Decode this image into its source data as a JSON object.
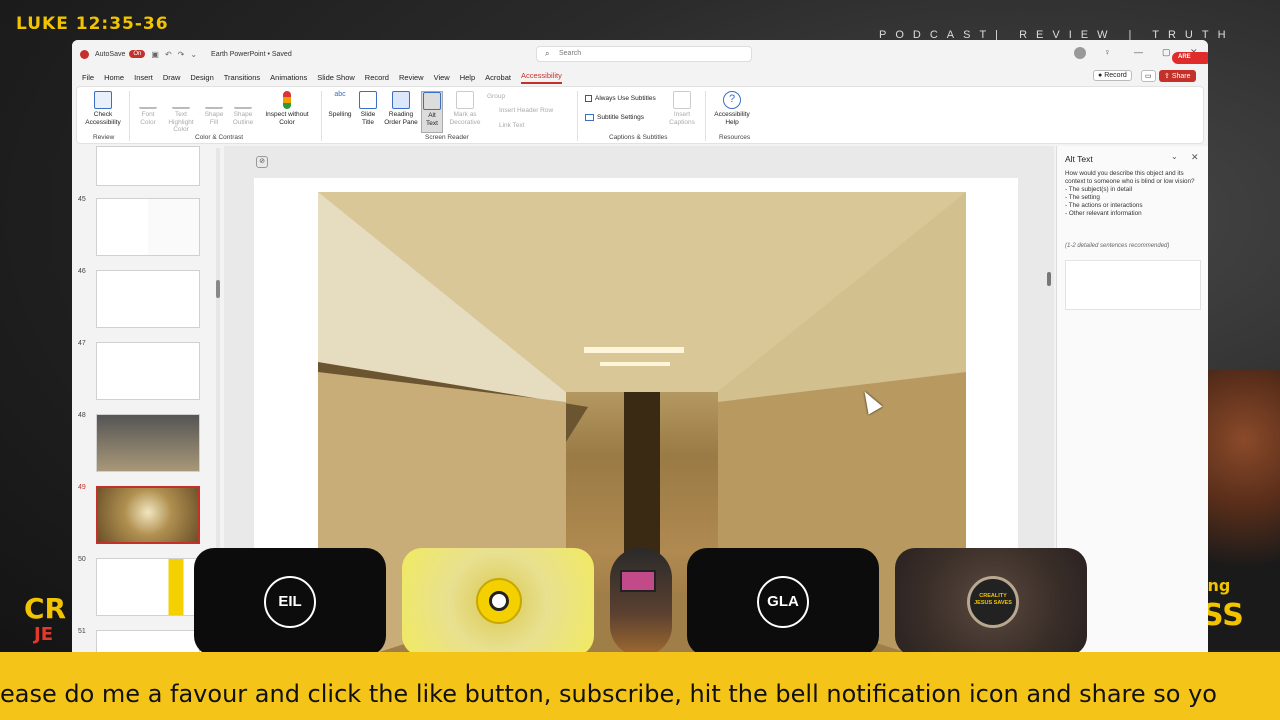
{
  "overlay": {
    "verse": "LUKE 12:35-36",
    "tagline": "PODCAST| REVIEW | TRUTH",
    "ticker": "ease do me a favour and click the like button, subscribe, hit the bell notification icon and share so yo"
  },
  "window": {
    "autosave_label": "AutoSave",
    "autosave_state": "On",
    "file_name": "Earth PowerPoint • Saved",
    "search_placeholder": "Search"
  },
  "menu": {
    "tabs": [
      "File",
      "Home",
      "Insert",
      "Draw",
      "Design",
      "Transitions",
      "Animations",
      "Slide Show",
      "Record",
      "Review",
      "View",
      "Help",
      "Acrobat",
      "Accessibility"
    ],
    "active_tab": "Accessibility",
    "record_label": "Record",
    "share_label": "Share"
  },
  "ribbon": {
    "buttons": [
      {
        "label": "Check Accessibility",
        "enabled": true
      },
      {
        "label": "Font Color",
        "enabled": false
      },
      {
        "label": "Text Highlight Color",
        "enabled": false
      },
      {
        "label": "Shape Fill",
        "enabled": false
      },
      {
        "label": "Shape Outline",
        "enabled": false
      },
      {
        "label": "Inspect without Color",
        "enabled": true
      },
      {
        "label": "Spelling",
        "enabled": true
      },
      {
        "label": "Slide Title",
        "enabled": true
      },
      {
        "label": "Reading Order Pane",
        "enabled": true
      },
      {
        "label": "Alt Text",
        "enabled": true
      },
      {
        "label": "Mark as Decorative",
        "enabled": false
      },
      {
        "label": "Group",
        "enabled": false
      },
      {
        "label": "Insert Header Row",
        "enabled": false
      },
      {
        "label": "Link Text",
        "enabled": false
      },
      {
        "label": "Always Use Subtitles",
        "enabled": true
      },
      {
        "label": "Subtitle Settings",
        "enabled": true
      },
      {
        "label": "Insert Captions",
        "enabled": false
      },
      {
        "label": "Accessibility Help",
        "enabled": true
      }
    ],
    "groups": [
      "Review",
      "Color & Contrast",
      "Screen Reader",
      "Captions & Subtitles",
      "Resources"
    ]
  },
  "slides": {
    "numbers": [
      "45",
      "46",
      "47",
      "48",
      "49",
      "50",
      "51"
    ],
    "selected": "49"
  },
  "alt_text_pane": {
    "title": "Alt Text",
    "description": "How would you describe this object and its context to someone who is blind or low vision?",
    "items": [
      "- The subject(s) in detail",
      "- The setting",
      "- The actions or interactions",
      "- Other relevant information"
    ],
    "hint": "(1-2 detailed sentences recommended)"
  },
  "participants": [
    {
      "initials": "EIL"
    },
    {
      "initials": ""
    },
    {
      "initials": ""
    },
    {
      "initials": "GLA"
    },
    {
      "initials": "CREALITY JESUS SAVES"
    }
  ],
  "branding": {
    "left_top": "CR",
    "left_bottom": "JE",
    "right_top": "ing",
    "right_bottom": "SS"
  },
  "colors": {
    "accent": "#c4312b",
    "ticker": "#f4c419",
    "verse": "#f2c400"
  }
}
